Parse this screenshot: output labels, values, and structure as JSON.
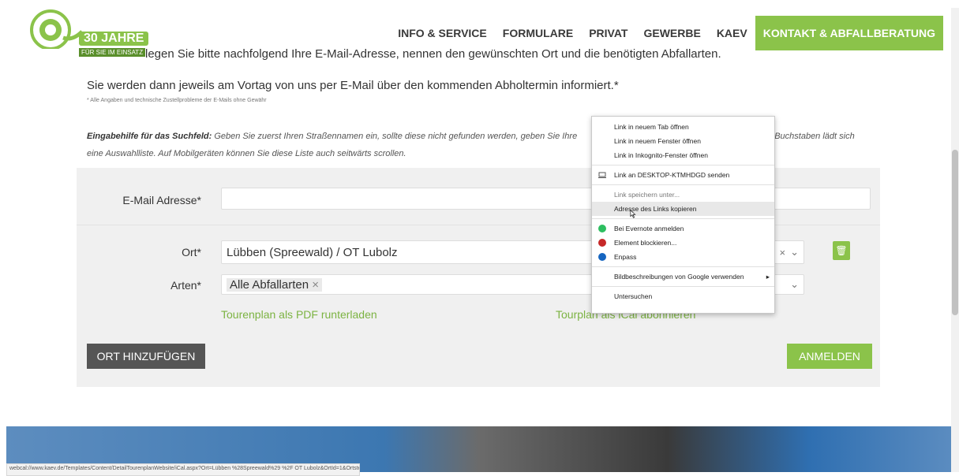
{
  "header": {
    "badge": "30 JAHRE",
    "badge_sub": "FÜR SIE IM EINSATZ",
    "menu": [
      {
        "label": "INFO & SERVICE"
      },
      {
        "label": "FORMULARE"
      },
      {
        "label": "PRIVAT"
      },
      {
        "label": "GEWERBE"
      },
      {
        "label": "KAEV"
      },
      {
        "label": "KONTAKT & ABFALLBERATUNG"
      }
    ]
  },
  "content": {
    "line1": "legen Sie bitte nachfolgend Ihre E-Mail-Adresse, nennen den gewünschten Ort und die benötigten Abfallarten.",
    "line2": "Sie werden dann jeweils am Vortag von uns per E-Mail über den kommenden Abholtermin informiert.*",
    "disclaimer": "* Alle Angaben und technische Zustellprobleme der E-Mails ohne Gewähr",
    "hint_label": "Eingabehilfe für das Suchfeld:",
    "hint_text_a": " Geben Sie zuerst Ihren Straßennamen ein, sollte diese nicht gefunden werden, geben Sie Ihre",
    "hint_text_b": "Buchstaben lädt sich",
    "hint_line2": "eine Auswahlliste. Auf Mobilgeräten können Sie diese Liste auch seitwärts scrollen."
  },
  "form": {
    "email_label": "E-Mail Adresse*",
    "email_value": "",
    "ort_label": "Ort*",
    "ort_value": "Lübben (Spreewald) / OT Lubolz",
    "arten_label": "Arten*",
    "arten_tag": "Alle Abfallarten",
    "tag_remove": "×",
    "select_clear": "×",
    "select_arrow": "⌄",
    "trash_glyph": "🗑",
    "pdf_link": "Tourenplan als PDF runterladen",
    "ical_link": "Tourplan als iCal abonnieren",
    "add_button": "ORT HINZUFÜGEN",
    "submit_button": "ANMELDEN"
  },
  "context_menu": [
    {
      "label": "Link in neuem Tab öffnen"
    },
    {
      "label": "Link in neuem Fenster öffnen"
    },
    {
      "label": "Link in Inkognito-Fenster öffnen"
    },
    {
      "label": "Link an DESKTOP-KTMHDGD senden"
    },
    {
      "label": "Link speichern unter..."
    },
    {
      "label": "Adresse des Links kopieren"
    },
    {
      "label": "Bei Evernote anmelden"
    },
    {
      "label": "Element blockieren..."
    },
    {
      "label": "Enpass"
    },
    {
      "label": "Bildbeschreibungen von Google verwenden"
    },
    {
      "label": "Untersuchen"
    }
  ],
  "status_url": "webcal://www.kaev.de/Templates/Content/DetailTourenplanWebsite/iCal.aspx?Ort=Lübben %28Spreewald%29 %2F OT Lubolz&OrtId=1&OrtsteilId=1",
  "colors": {
    "accent": "#8bc34a",
    "dark_button": "#555555"
  }
}
